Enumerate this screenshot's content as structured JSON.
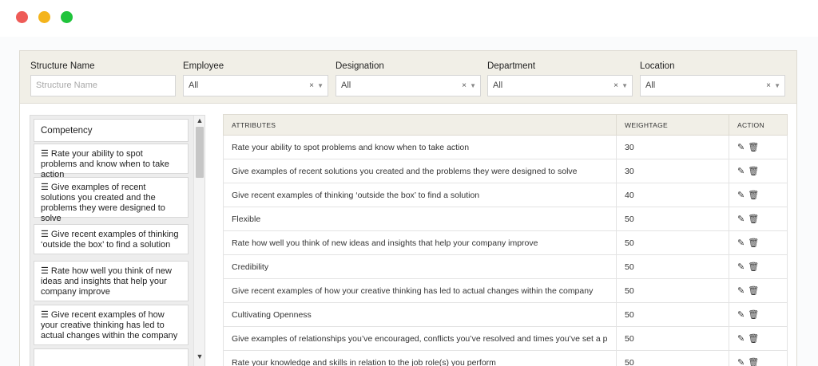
{
  "window": {
    "controls": [
      "close",
      "minimize",
      "maximize"
    ]
  },
  "filters": {
    "structure_name": {
      "label": "Structure Name",
      "placeholder": "Structure Name",
      "value": ""
    },
    "employee": {
      "label": "Employee",
      "value": "All"
    },
    "designation": {
      "label": "Designation",
      "value": "All"
    },
    "department": {
      "label": "Department",
      "value": "All"
    },
    "location": {
      "label": "Location",
      "value": "All"
    },
    "clear_glyph": "×",
    "caret_glyph": "▼"
  },
  "competency": {
    "header": "Competency",
    "items": [
      "Rate your ability to spot problems and know when to take action",
      "Give examples of recent solutions you created and the problems they were designed to solve",
      "Give recent examples of thinking ‘outside the box’ to find a solution",
      "Rate how well you think of new ideas and insights that help your company improve",
      "Give recent examples of how your creative thinking has led to actual changes within the company"
    ],
    "drag_icon": "drag-handle-icon"
  },
  "table": {
    "columns": [
      "ATTRIBUTES",
      "WEIGHTAGE",
      "ACTION"
    ],
    "rows": [
      {
        "attribute": "Rate your ability to spot problems and know when to take action",
        "weightage": "30"
      },
      {
        "attribute": "Give examples of recent solutions you created and the problems they were designed to solve",
        "weightage": "30"
      },
      {
        "attribute": "Give recent examples of thinking ‘outside the box’ to find a solution",
        "weightage": "40"
      },
      {
        "attribute": "Flexible",
        "weightage": "50"
      },
      {
        "attribute": "Rate how well you think of new ideas and insights that help your company improve",
        "weightage": "50"
      },
      {
        "attribute": "Credibility",
        "weightage": "50"
      },
      {
        "attribute": "Give recent examples of how your creative thinking has led to actual changes within the company",
        "weightage": "50"
      },
      {
        "attribute": "Cultivating Openness",
        "weightage": "50"
      },
      {
        "attribute": "Give examples of relationships you’ve encouraged, conflicts you’ve resolved and times you’ve set a p",
        "weightage": "50"
      },
      {
        "attribute": "Rate your knowledge and skills in relation to the job role(s) you perform",
        "weightage": "50"
      }
    ],
    "edit_icon": "edit-pencil-icon",
    "delete_icon": "delete-trash-icon"
  },
  "colors": {
    "header_bg": "#f1efe7",
    "close": "#ee5b57",
    "minimize": "#f4b41c",
    "maximize": "#1fc43b"
  }
}
